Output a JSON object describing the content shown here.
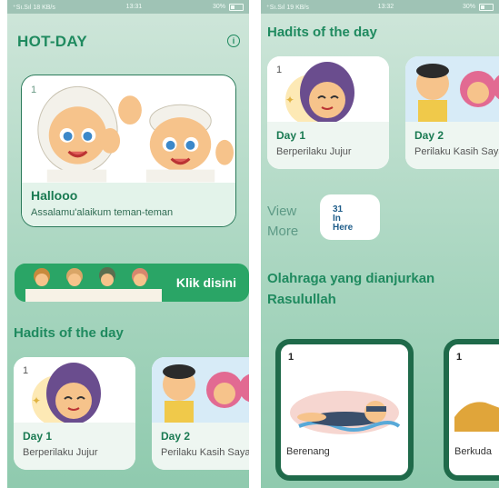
{
  "left": {
    "status": {
      "signal": "⁺Sı.Sıl 18 KB/s",
      "time": "13:31",
      "battery": "30%"
    },
    "app_title": "HOT-DAY",
    "hero": {
      "number": "1",
      "title": "Hallooo",
      "subtitle": "Assalamu'alaikum teman-teman"
    },
    "banner": {
      "label": "Klik disini"
    },
    "hadits_title": "Hadits of the day",
    "cards": [
      {
        "number": "1",
        "day": "Day 1",
        "desc": "Berperilaku Jujur"
      },
      {
        "number": "",
        "day": "Day 2",
        "desc": "Perilaku Kasih Sayang"
      }
    ]
  },
  "right": {
    "status": {
      "signal": "⁺Sı.Sıl 19 KB/s",
      "time": "13:32",
      "battery": "30%"
    },
    "hadits_title": "Hadits of the day",
    "cards": [
      {
        "number": "1",
        "day": "Day 1",
        "desc": "Berperilaku Jujur"
      },
      {
        "number": "",
        "day": "Day 2",
        "desc": "Perilaku Kasih Sayang"
      }
    ],
    "view_more": {
      "line1": "View",
      "line2": "More"
    },
    "view_more_card": {
      "line1": "31",
      "line2": "In",
      "line3": "Here"
    },
    "sport_title": "Olahraga yang dianjurkan Rasulullah",
    "sports": [
      {
        "number": "1",
        "label": "Berenang"
      },
      {
        "number": "1",
        "label": "Berkuda"
      }
    ]
  },
  "colors": {
    "accent": "#1f8a5f",
    "banner": "#2aa566",
    "card_border": "#1f6a4a"
  },
  "icons": [
    "info-icon",
    "battery-icon",
    "signal-icon"
  ]
}
